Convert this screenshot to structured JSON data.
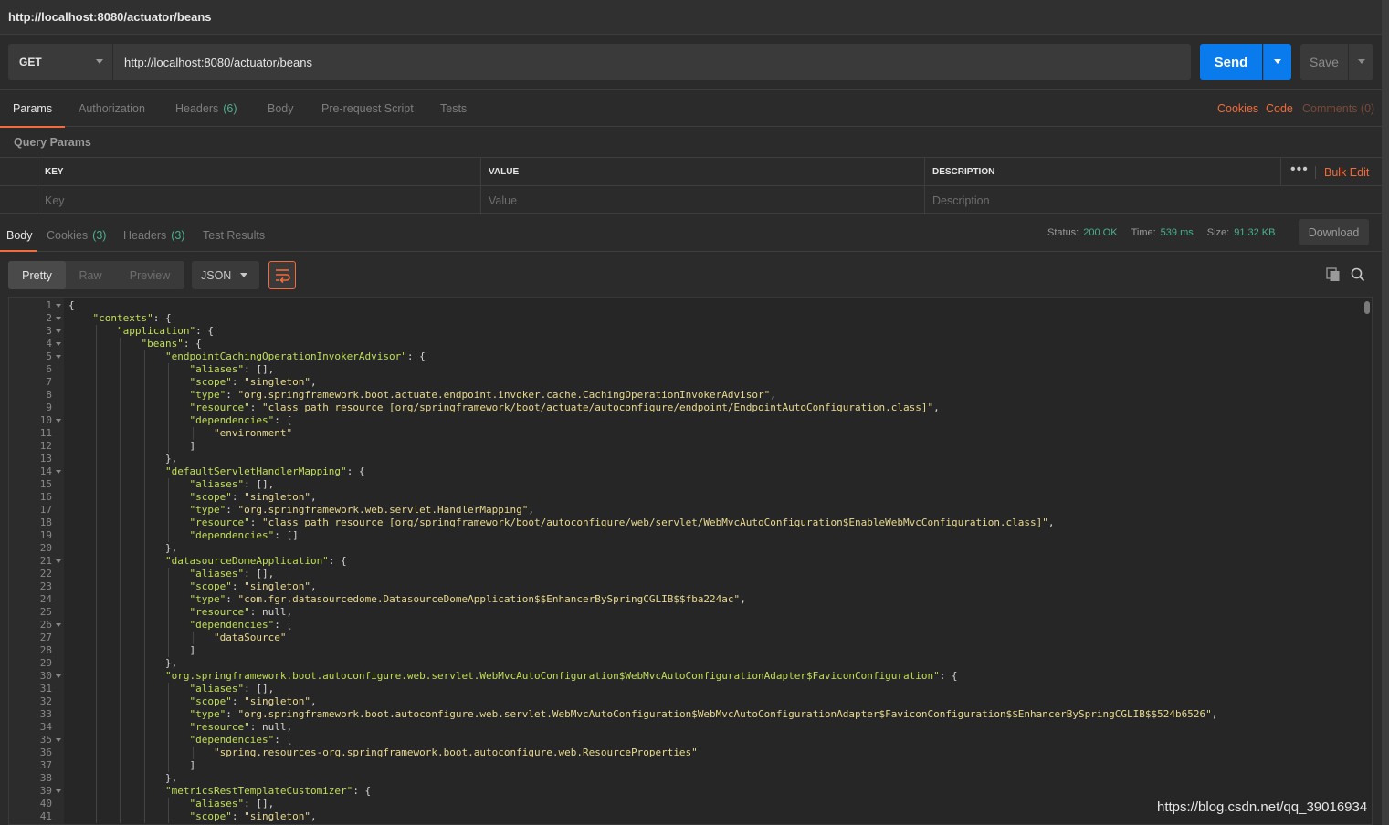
{
  "window": {
    "title": "http://localhost:8080/actuator/beans"
  },
  "request": {
    "method": "GET",
    "url": "http://localhost:8080/actuator/beans",
    "send_label": "Send",
    "save_label": "Save"
  },
  "request_tabs": [
    {
      "label": "Params",
      "count": ""
    },
    {
      "label": "Authorization",
      "count": ""
    },
    {
      "label": "Headers",
      "count": "(6)"
    },
    {
      "label": "Body",
      "count": ""
    },
    {
      "label": "Pre-request Script",
      "count": ""
    },
    {
      "label": "Tests",
      "count": ""
    }
  ],
  "right_links": {
    "cookies": "Cookies",
    "code": "Code",
    "comments": "Comments (0)"
  },
  "query_params": {
    "label": "Query Params",
    "headers": {
      "key": "KEY",
      "value": "VALUE",
      "description": "DESCRIPTION"
    },
    "placeholders": {
      "key": "Key",
      "value": "Value",
      "description": "Description"
    },
    "more": "•••",
    "bulk_edit": "Bulk Edit"
  },
  "response_tabs": [
    {
      "label": "Body",
      "count": ""
    },
    {
      "label": "Cookies",
      "count": "(3)"
    },
    {
      "label": "Headers",
      "count": "(3)"
    },
    {
      "label": "Test Results",
      "count": ""
    }
  ],
  "response_status": {
    "status_label": "Status:",
    "status_value": "200 OK",
    "time_label": "Time:",
    "time_value": "539 ms",
    "size_label": "Size:",
    "size_value": "91.32 KB",
    "download_label": "Download"
  },
  "view": {
    "pretty": "Pretty",
    "raw": "Raw",
    "preview": "Preview",
    "format": "JSON"
  },
  "code_lines": [
    {
      "n": "1",
      "fold": true,
      "indent": 0,
      "text": "{"
    },
    {
      "n": "2",
      "fold": true,
      "indent": 1,
      "key": "\"contexts\"",
      "rest": ": {"
    },
    {
      "n": "3",
      "fold": true,
      "indent": 2,
      "key": "\"application\"",
      "rest": ": {"
    },
    {
      "n": "4",
      "fold": true,
      "indent": 3,
      "key": "\"beans\"",
      "rest": ": {"
    },
    {
      "n": "5",
      "fold": true,
      "indent": 4,
      "key": "\"endpointCachingOperationInvokerAdvisor\"",
      "rest": ": {"
    },
    {
      "n": "6",
      "fold": false,
      "indent": 5,
      "key": "\"aliases\"",
      "rest": ": [],"
    },
    {
      "n": "7",
      "fold": false,
      "indent": 5,
      "key": "\"scope\"",
      "rest": ": ",
      "str": "\"singleton\"",
      "tail": ","
    },
    {
      "n": "8",
      "fold": false,
      "indent": 5,
      "key": "\"type\"",
      "rest": ": ",
      "str": "\"org.springframework.boot.actuate.endpoint.invoker.cache.CachingOperationInvokerAdvisor\"",
      "tail": ","
    },
    {
      "n": "9",
      "fold": false,
      "indent": 5,
      "key": "\"resource\"",
      "rest": ": ",
      "str": "\"class path resource [org/springframework/boot/actuate/autoconfigure/endpoint/EndpointAutoConfiguration.class]\"",
      "tail": ","
    },
    {
      "n": "10",
      "fold": true,
      "indent": 5,
      "key": "\"dependencies\"",
      "rest": ": ["
    },
    {
      "n": "11",
      "fold": false,
      "indent": 6,
      "str": "\"environment\"",
      "tail": ""
    },
    {
      "n": "12",
      "fold": false,
      "indent": 5,
      "text": "]"
    },
    {
      "n": "13",
      "fold": false,
      "indent": 4,
      "text": "},"
    },
    {
      "n": "14",
      "fold": true,
      "indent": 4,
      "key": "\"defaultServletHandlerMapping\"",
      "rest": ": {"
    },
    {
      "n": "15",
      "fold": false,
      "indent": 5,
      "key": "\"aliases\"",
      "rest": ": [],"
    },
    {
      "n": "16",
      "fold": false,
      "indent": 5,
      "key": "\"scope\"",
      "rest": ": ",
      "str": "\"singleton\"",
      "tail": ","
    },
    {
      "n": "17",
      "fold": false,
      "indent": 5,
      "key": "\"type\"",
      "rest": ": ",
      "str": "\"org.springframework.web.servlet.HandlerMapping\"",
      "tail": ","
    },
    {
      "n": "18",
      "fold": false,
      "indent": 5,
      "key": "\"resource\"",
      "rest": ": ",
      "str": "\"class path resource [org/springframework/boot/autoconfigure/web/servlet/WebMvcAutoConfiguration$EnableWebMvcConfiguration.class]\"",
      "tail": ","
    },
    {
      "n": "19",
      "fold": false,
      "indent": 5,
      "key": "\"dependencies\"",
      "rest": ": []"
    },
    {
      "n": "20",
      "fold": false,
      "indent": 4,
      "text": "},"
    },
    {
      "n": "21",
      "fold": true,
      "indent": 4,
      "key": "\"datasourceDomeApplication\"",
      "rest": ": {"
    },
    {
      "n": "22",
      "fold": false,
      "indent": 5,
      "key": "\"aliases\"",
      "rest": ": [],"
    },
    {
      "n": "23",
      "fold": false,
      "indent": 5,
      "key": "\"scope\"",
      "rest": ": ",
      "str": "\"singleton\"",
      "tail": ","
    },
    {
      "n": "24",
      "fold": false,
      "indent": 5,
      "key": "\"type\"",
      "rest": ": ",
      "str": "\"com.fgr.datasourcedome.DatasourceDomeApplication$$EnhancerBySpringCGLIB$$fba224ac\"",
      "tail": ","
    },
    {
      "n": "25",
      "fold": false,
      "indent": 5,
      "key": "\"resource\"",
      "rest": ": null,"
    },
    {
      "n": "26",
      "fold": true,
      "indent": 5,
      "key": "\"dependencies\"",
      "rest": ": ["
    },
    {
      "n": "27",
      "fold": false,
      "indent": 6,
      "str": "\"dataSource\"",
      "tail": ""
    },
    {
      "n": "28",
      "fold": false,
      "indent": 5,
      "text": "]"
    },
    {
      "n": "29",
      "fold": false,
      "indent": 4,
      "text": "},"
    },
    {
      "n": "30",
      "fold": true,
      "indent": 4,
      "key": "\"org.springframework.boot.autoconfigure.web.servlet.WebMvcAutoConfiguration$WebMvcAutoConfigurationAdapter$FaviconConfiguration\"",
      "rest": ": {"
    },
    {
      "n": "31",
      "fold": false,
      "indent": 5,
      "key": "\"aliases\"",
      "rest": ": [],"
    },
    {
      "n": "32",
      "fold": false,
      "indent": 5,
      "key": "\"scope\"",
      "rest": ": ",
      "str": "\"singleton\"",
      "tail": ","
    },
    {
      "n": "33",
      "fold": false,
      "indent": 5,
      "key": "\"type\"",
      "rest": ": ",
      "str": "\"org.springframework.boot.autoconfigure.web.servlet.WebMvcAutoConfiguration$WebMvcAutoConfigurationAdapter$FaviconConfiguration$$EnhancerBySpringCGLIB$$524b6526\"",
      "tail": ","
    },
    {
      "n": "34",
      "fold": false,
      "indent": 5,
      "key": "\"resource\"",
      "rest": ": null,"
    },
    {
      "n": "35",
      "fold": true,
      "indent": 5,
      "key": "\"dependencies\"",
      "rest": ": ["
    },
    {
      "n": "36",
      "fold": false,
      "indent": 6,
      "str": "\"spring.resources-org.springframework.boot.autoconfigure.web.ResourceProperties\"",
      "tail": ""
    },
    {
      "n": "37",
      "fold": false,
      "indent": 5,
      "text": "]"
    },
    {
      "n": "38",
      "fold": false,
      "indent": 4,
      "text": "},"
    },
    {
      "n": "39",
      "fold": true,
      "indent": 4,
      "key": "\"metricsRestTemplateCustomizer\"",
      "rest": ": {"
    },
    {
      "n": "40",
      "fold": false,
      "indent": 5,
      "key": "\"aliases\"",
      "rest": ": [],"
    },
    {
      "n": "41",
      "fold": false,
      "indent": 5,
      "key": "\"scope\"",
      "rest": ": ",
      "str": "\"singleton\"",
      "tail": ","
    }
  ],
  "watermark": "https://blog.csdn.net/qq_39016934",
  "colors": {
    "accent": "#f26b3a",
    "send": "#097bed",
    "success": "#4cb08d",
    "json_key": "#c0de5a",
    "json_string": "#e8d990"
  }
}
